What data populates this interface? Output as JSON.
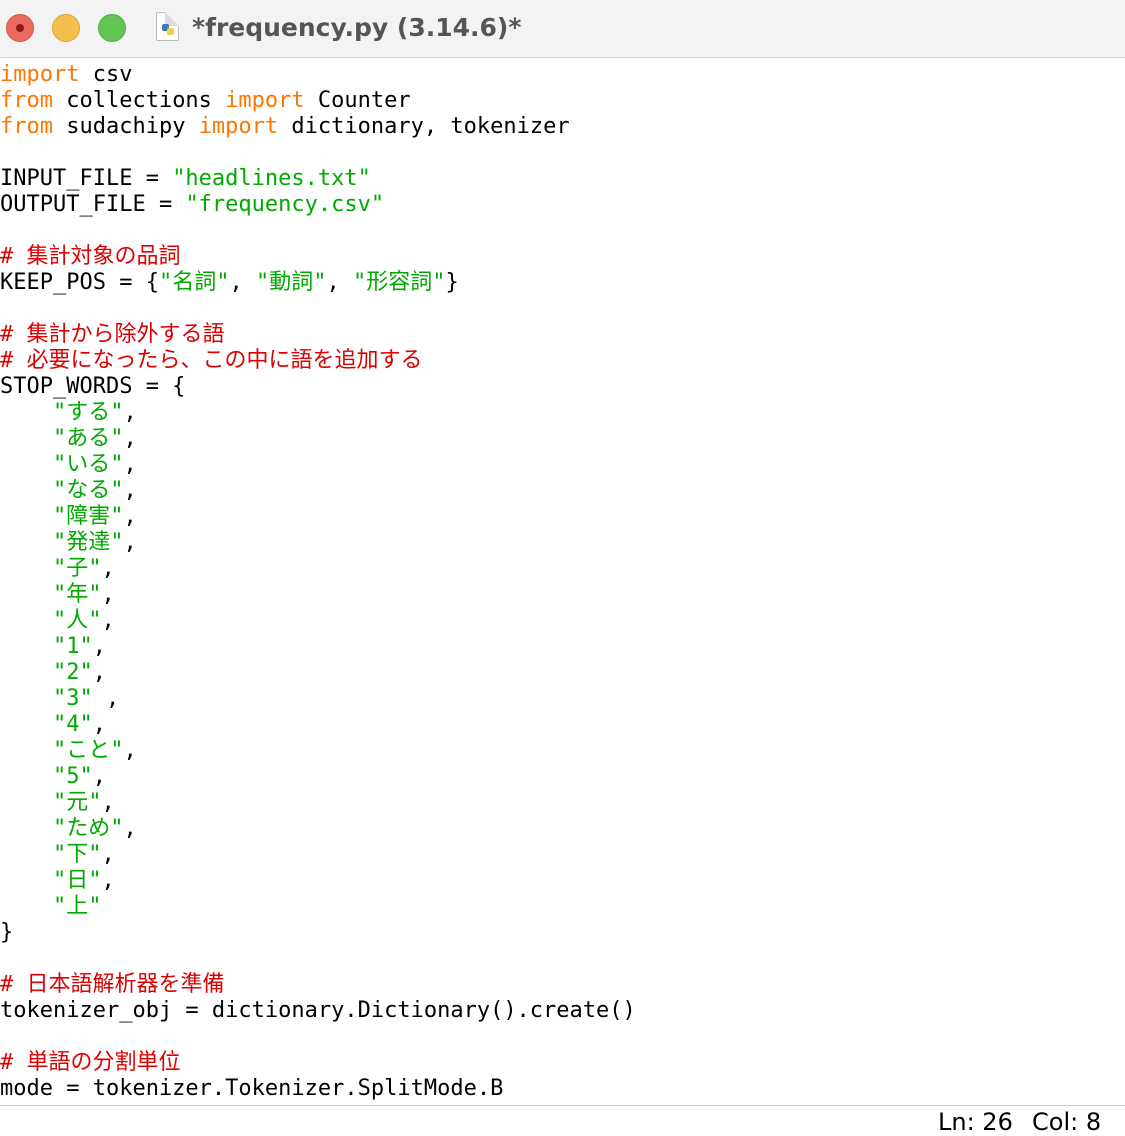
{
  "window": {
    "title": "*frequency.py (3.14.6)*",
    "file_icon": "python-file-icon"
  },
  "colors": {
    "keyword": "#ff7700",
    "string": "#00aa00",
    "comment": "#dd0000",
    "default": "#000000"
  },
  "code": [
    [
      {
        "t": "kw",
        "v": "import"
      },
      {
        "t": "",
        "v": " csv"
      }
    ],
    [
      {
        "t": "kw",
        "v": "from"
      },
      {
        "t": "",
        "v": " collections "
      },
      {
        "t": "kw",
        "v": "import"
      },
      {
        "t": "",
        "v": " Counter"
      }
    ],
    [
      {
        "t": "kw",
        "v": "from"
      },
      {
        "t": "",
        "v": " sudachipy "
      },
      {
        "t": "kw",
        "v": "import"
      },
      {
        "t": "",
        "v": " dictionary, tokenizer"
      }
    ],
    [],
    [
      {
        "t": "",
        "v": "INPUT_FILE = "
      },
      {
        "t": "str",
        "v": "\"headlines.txt\""
      }
    ],
    [
      {
        "t": "",
        "v": "OUTPUT_FILE = "
      },
      {
        "t": "str",
        "v": "\"frequency.csv\""
      }
    ],
    [],
    [
      {
        "t": "com",
        "v": "# 集計対象の品詞"
      }
    ],
    [
      {
        "t": "",
        "v": "KEEP_POS = {"
      },
      {
        "t": "str",
        "v": "\"名詞\""
      },
      {
        "t": "",
        "v": ", "
      },
      {
        "t": "str",
        "v": "\"動詞\""
      },
      {
        "t": "",
        "v": ", "
      },
      {
        "t": "str",
        "v": "\"形容詞\""
      },
      {
        "t": "",
        "v": "}"
      }
    ],
    [],
    [
      {
        "t": "com",
        "v": "# 集計から除外する語"
      }
    ],
    [
      {
        "t": "com",
        "v": "# 必要になったら、この中に語を追加する"
      }
    ],
    [
      {
        "t": "",
        "v": "STOP_WORDS = {"
      }
    ],
    [
      {
        "t": "",
        "v": "    "
      },
      {
        "t": "str",
        "v": "\"する\""
      },
      {
        "t": "",
        "v": ","
      }
    ],
    [
      {
        "t": "",
        "v": "    "
      },
      {
        "t": "str",
        "v": "\"ある\""
      },
      {
        "t": "",
        "v": ","
      }
    ],
    [
      {
        "t": "",
        "v": "    "
      },
      {
        "t": "str",
        "v": "\"いる\""
      },
      {
        "t": "",
        "v": ","
      }
    ],
    [
      {
        "t": "",
        "v": "    "
      },
      {
        "t": "str",
        "v": "\"なる\""
      },
      {
        "t": "",
        "v": ","
      }
    ],
    [
      {
        "t": "",
        "v": "    "
      },
      {
        "t": "str",
        "v": "\"障害\""
      },
      {
        "t": "",
        "v": ","
      }
    ],
    [
      {
        "t": "",
        "v": "    "
      },
      {
        "t": "str",
        "v": "\"発達\""
      },
      {
        "t": "",
        "v": ","
      }
    ],
    [
      {
        "t": "",
        "v": "    "
      },
      {
        "t": "str",
        "v": "\"子\""
      },
      {
        "t": "",
        "v": ","
      }
    ],
    [
      {
        "t": "",
        "v": "    "
      },
      {
        "t": "str",
        "v": "\"年\""
      },
      {
        "t": "",
        "v": ","
      }
    ],
    [
      {
        "t": "",
        "v": "    "
      },
      {
        "t": "str",
        "v": "\"人\""
      },
      {
        "t": "",
        "v": ","
      }
    ],
    [
      {
        "t": "",
        "v": "    "
      },
      {
        "t": "str",
        "v": "\"1\""
      },
      {
        "t": "",
        "v": ","
      }
    ],
    [
      {
        "t": "",
        "v": "    "
      },
      {
        "t": "str",
        "v": "\"2\""
      },
      {
        "t": "",
        "v": ","
      }
    ],
    [
      {
        "t": "",
        "v": "    "
      },
      {
        "t": "str",
        "v": "\"3\""
      },
      {
        "t": "",
        "v": " ,"
      }
    ],
    [
      {
        "t": "",
        "v": "    "
      },
      {
        "t": "str",
        "v": "\"4\""
      },
      {
        "t": "",
        "v": ","
      }
    ],
    [
      {
        "t": "",
        "v": "    "
      },
      {
        "t": "str",
        "v": "\"こと\""
      },
      {
        "t": "",
        "v": ","
      }
    ],
    [
      {
        "t": "",
        "v": "    "
      },
      {
        "t": "str",
        "v": "\"5\""
      },
      {
        "t": "",
        "v": ","
      }
    ],
    [
      {
        "t": "",
        "v": "    "
      },
      {
        "t": "str",
        "v": "\"元\""
      },
      {
        "t": "",
        "v": ","
      }
    ],
    [
      {
        "t": "",
        "v": "    "
      },
      {
        "t": "str",
        "v": "\"ため\""
      },
      {
        "t": "",
        "v": ","
      }
    ],
    [
      {
        "t": "",
        "v": "    "
      },
      {
        "t": "str",
        "v": "\"下\""
      },
      {
        "t": "",
        "v": ","
      }
    ],
    [
      {
        "t": "",
        "v": "    "
      },
      {
        "t": "str",
        "v": "\"日\""
      },
      {
        "t": "",
        "v": ","
      }
    ],
    [
      {
        "t": "",
        "v": "    "
      },
      {
        "t": "str",
        "v": "\"上\""
      }
    ],
    [
      {
        "t": "",
        "v": "}"
      }
    ],
    [],
    [
      {
        "t": "com",
        "v": "# 日本語解析器を準備"
      }
    ],
    [
      {
        "t": "",
        "v": "tokenizer_obj = dictionary.Dictionary().create()"
      }
    ],
    [],
    [
      {
        "t": "com",
        "v": "# 単語の分割単位"
      }
    ],
    [
      {
        "t": "",
        "v": "mode = tokenizer.Tokenizer.SplitMode.B"
      }
    ]
  ],
  "status": {
    "line": "Ln: 26",
    "column": "Col: 8"
  }
}
